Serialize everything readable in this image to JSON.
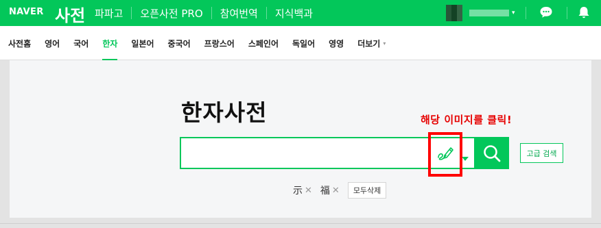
{
  "header": {
    "logo": "NAVER",
    "brand": "사전",
    "nav": [
      "파파고",
      "오픈사전 PRO",
      "참여번역",
      "지식백과"
    ],
    "user_caret": "▾",
    "icons": [
      "chat-icon",
      "bell-icon"
    ]
  },
  "subnav": {
    "tabs": [
      "사전홈",
      "영어",
      "국어",
      "한자",
      "일본어",
      "중국어",
      "프랑스어",
      "스페인어",
      "독일어",
      "영영",
      "더보기"
    ],
    "active_tab": "한자",
    "more_caret": "▾"
  },
  "main": {
    "title": "한자사전",
    "annotation": "해당 이미지를 클릭!",
    "search": {
      "value": "",
      "placeholder": ""
    },
    "advanced_search_label": "고급 검색",
    "history": [
      {
        "char": "示",
        "remove": "✕"
      },
      {
        "char": "福",
        "remove": "✕"
      }
    ],
    "clear_all_label": "모두삭제"
  },
  "colors": {
    "brand_green": "#03c75a",
    "highlight_red": "#ff0000",
    "annotation_red": "#e60000"
  }
}
